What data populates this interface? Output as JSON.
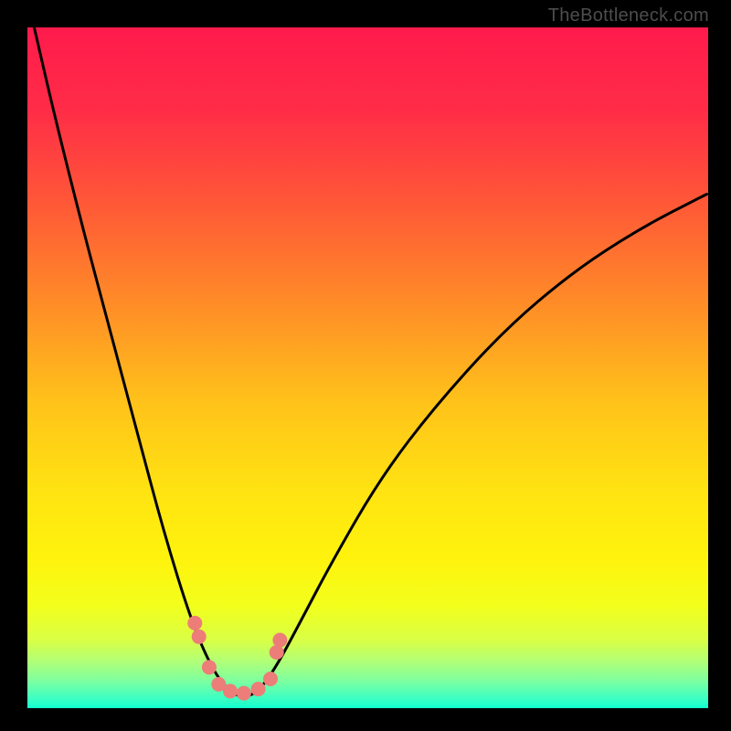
{
  "watermark": "TheBottleneck.com",
  "gradient_stops": [
    {
      "offset": 0,
      "color": "#ff1b4c"
    },
    {
      "offset": 0.12,
      "color": "#ff2c47"
    },
    {
      "offset": 0.25,
      "color": "#ff5538"
    },
    {
      "offset": 0.4,
      "color": "#ff8a28"
    },
    {
      "offset": 0.55,
      "color": "#ffc21a"
    },
    {
      "offset": 0.68,
      "color": "#ffe312"
    },
    {
      "offset": 0.78,
      "color": "#fff30d"
    },
    {
      "offset": 0.85,
      "color": "#f2ff1c"
    },
    {
      "offset": 0.9,
      "color": "#d9ff45"
    },
    {
      "offset": 0.93,
      "color": "#b3ff75"
    },
    {
      "offset": 0.96,
      "color": "#7dffa0"
    },
    {
      "offset": 0.985,
      "color": "#3effc2"
    },
    {
      "offset": 1.0,
      "color": "#12ffd0"
    }
  ],
  "curve": {
    "stroke": "#000000",
    "stroke_width": 3
  },
  "markers": {
    "fill": "#ec7d78",
    "radius": 8,
    "points": [
      {
        "x": 0.246,
        "y": 0.875
      },
      {
        "x": 0.252,
        "y": 0.895
      },
      {
        "x": 0.267,
        "y": 0.94
      },
      {
        "x": 0.281,
        "y": 0.965
      },
      {
        "x": 0.298,
        "y": 0.975
      },
      {
        "x": 0.318,
        "y": 0.978
      },
      {
        "x": 0.339,
        "y": 0.972
      },
      {
        "x": 0.357,
        "y": 0.957
      },
      {
        "x": 0.366,
        "y": 0.918
      },
      {
        "x": 0.371,
        "y": 0.9
      }
    ]
  },
  "chart_data": {
    "type": "line",
    "title": "",
    "xlabel": "",
    "ylabel": "",
    "x_range": [
      0,
      1
    ],
    "y_range": [
      1,
      0
    ],
    "series": [
      {
        "name": "bottleneck-curve",
        "x": [
          0.01,
          0.04,
          0.08,
          0.12,
          0.16,
          0.2,
          0.24,
          0.27,
          0.295,
          0.318,
          0.34,
          0.365,
          0.4,
          0.45,
          0.52,
          0.6,
          0.7,
          0.8,
          0.9,
          0.998
        ],
        "y": [
          0.0,
          0.13,
          0.29,
          0.44,
          0.59,
          0.74,
          0.87,
          0.94,
          0.975,
          0.985,
          0.975,
          0.94,
          0.875,
          0.78,
          0.66,
          0.555,
          0.445,
          0.36,
          0.295,
          0.245
        ]
      }
    ],
    "markers_series": {
      "name": "highlighted-points",
      "x": [
        0.246,
        0.252,
        0.267,
        0.281,
        0.298,
        0.318,
        0.339,
        0.357,
        0.366,
        0.371
      ],
      "y": [
        0.875,
        0.895,
        0.94,
        0.965,
        0.975,
        0.978,
        0.972,
        0.957,
        0.918,
        0.9
      ]
    },
    "background_gradient": "red-yellow-green-vertical"
  }
}
